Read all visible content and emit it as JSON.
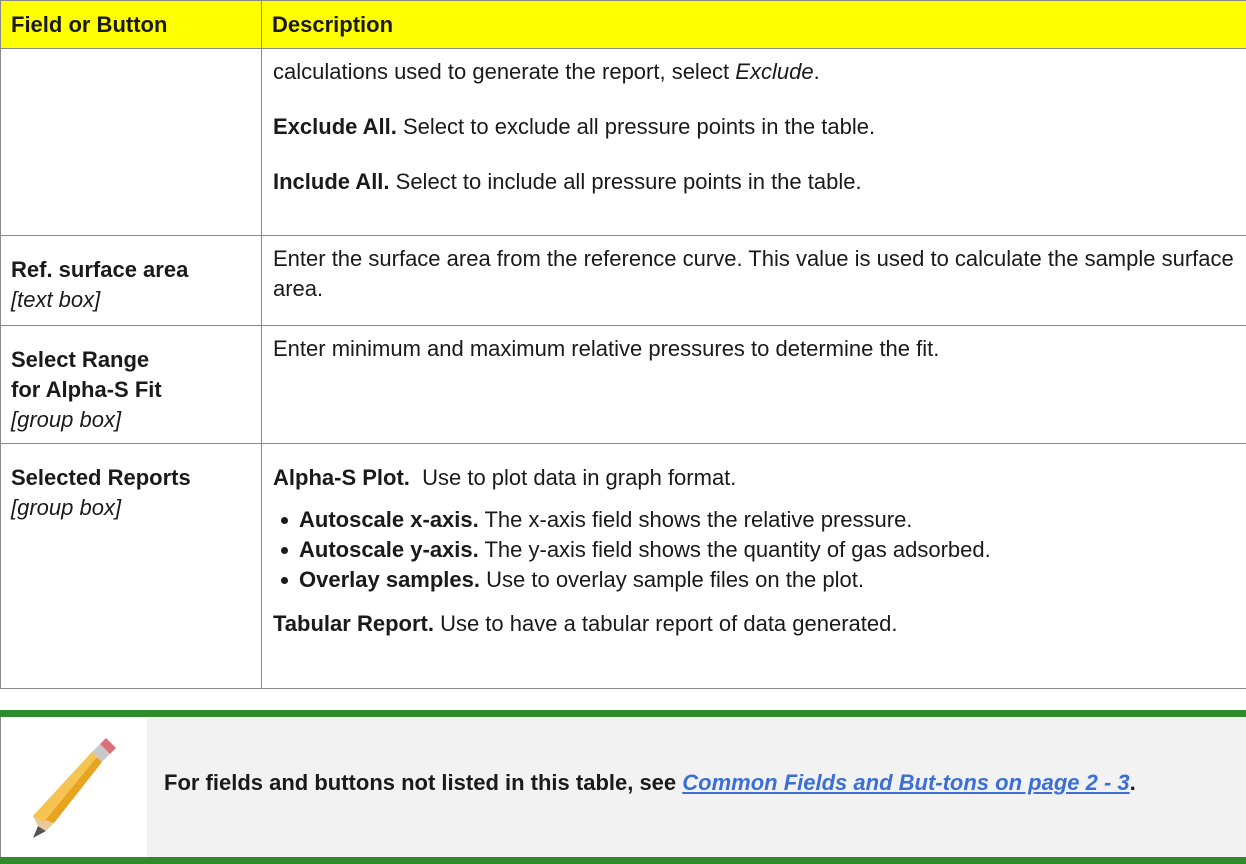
{
  "table": {
    "headers": {
      "field": "Field or Button",
      "description": "Description"
    },
    "row_continued": {
      "line1_text": "calculations used to generate the report, select ",
      "line1_emph": "Exclude",
      "line1_end": ".",
      "exclude_all_label": "Exclude All.",
      "exclude_all_text": " Select to exclude all pressure points in the table.",
      "include_all_label": "Include All.",
      "include_all_text": " Select to include all pressure points in the table."
    },
    "row_ref_surface": {
      "field_name": "Ref. surface area",
      "field_type": "[text box]",
      "description": "Enter the surface area from the reference curve. This value is used to calculate the sample surface area."
    },
    "row_select_range": {
      "field_name_1": "Select Range",
      "field_name_2": "for Alpha-S Fit",
      "field_type": "[group box]",
      "description": "Enter minimum and maximum relative pressures to determine the fit."
    },
    "row_selected_reports": {
      "field_name": "Selected Reports",
      "field_type": "[group box]",
      "alpha_label": "Alpha-S Plot.",
      "alpha_text": "  Use to plot data in graph format.",
      "bullets": [
        {
          "label": "Autoscale x-axis.",
          "text": " The x-axis field shows the relative pressure."
        },
        {
          "label": "Autoscale y-axis.",
          "text": " The y-axis field shows the quantity of gas adsorbed."
        },
        {
          "label": "Overlay samples.",
          "text": " Use to overlay sample files on the plot."
        }
      ],
      "tabular_label": "Tabular Report.",
      "tabular_text": " Use to have a tabular report of data generated."
    }
  },
  "note": {
    "icon": "pencil-icon",
    "text_before": "For fields and buttons not listed in this table, see ",
    "link_text": "Common Fields and But-tons on page 2 - 3",
    "text_after": ".",
    "colors": {
      "bar": "#2e8b2e",
      "link": "#3b6fd6",
      "header": "#ffff00"
    }
  }
}
